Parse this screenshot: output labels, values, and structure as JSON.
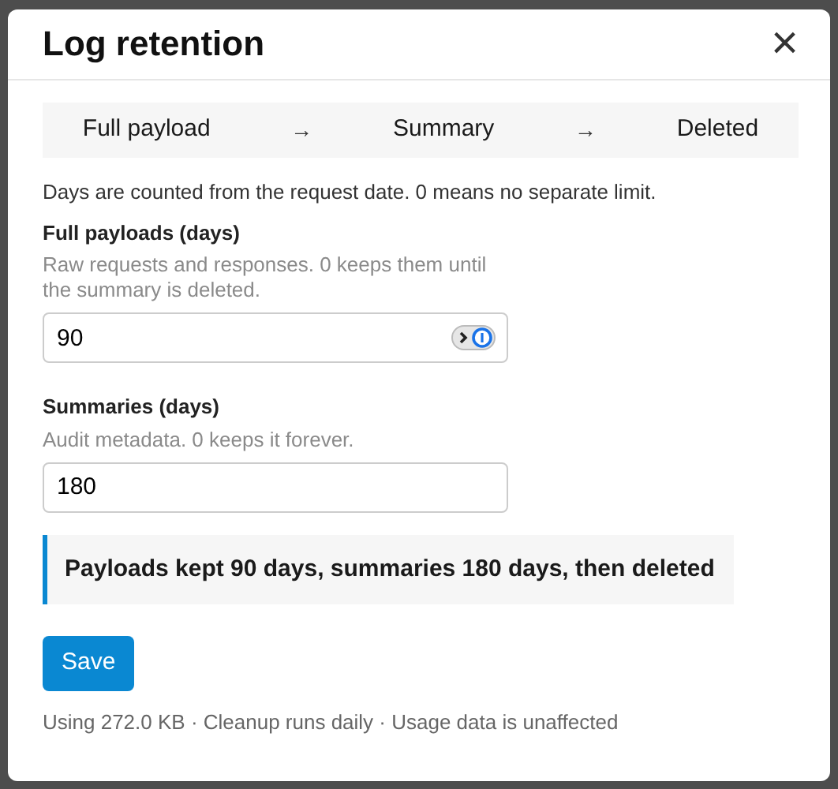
{
  "dialog": {
    "title": "Log retention",
    "close": "×"
  },
  "flow": [
    {
      "kind": "step",
      "text": "Full payload"
    },
    {
      "kind": "arrow",
      "text": "→"
    },
    {
      "kind": "step",
      "text": "Summary"
    },
    {
      "kind": "arrow",
      "text": "→"
    },
    {
      "kind": "step",
      "text": "Deleted"
    }
  ],
  "note": "Days are counted from the request date. 0 means no separate limit.",
  "fields": [
    {
      "label": "Full payloads (days)",
      "help": "Raw requests and responses. 0 keeps them until the summary is deleted.",
      "value": "90",
      "autofill_icon": true
    },
    {
      "label": "Summaries (days)",
      "help": "Audit metadata. 0 keeps it forever.",
      "value": "180"
    }
  ],
  "summary": "Payloads kept 90 days, summaries 180 days, then deleted",
  "save_button": "Save",
  "footer": "Using 272.0 KB · Cleanup runs daily · Usage data is unaffected"
}
